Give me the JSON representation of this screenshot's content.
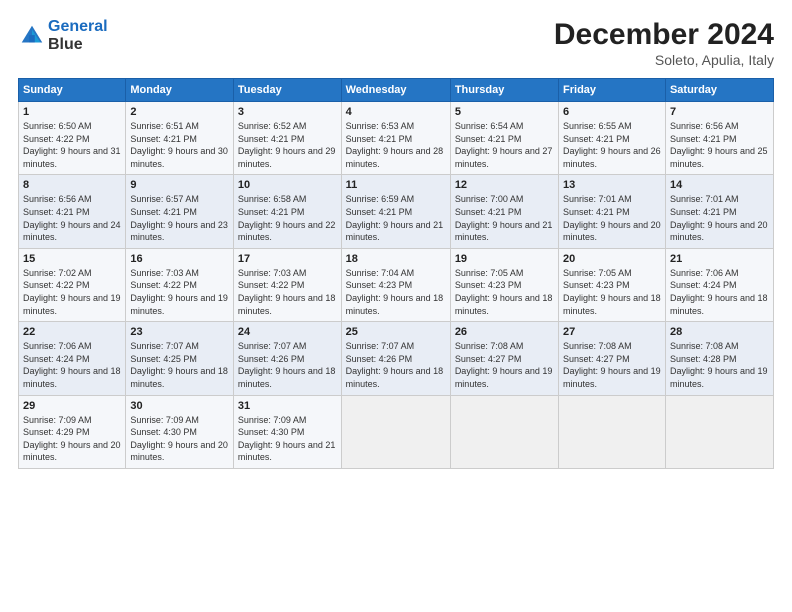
{
  "header": {
    "logo_line1": "General",
    "logo_line2": "Blue",
    "month": "December 2024",
    "location": "Soleto, Apulia, Italy"
  },
  "weekdays": [
    "Sunday",
    "Monday",
    "Tuesday",
    "Wednesday",
    "Thursday",
    "Friday",
    "Saturday"
  ],
  "weeks": [
    [
      {
        "day": "1",
        "sunrise": "6:50 AM",
        "sunset": "4:22 PM",
        "daylight": "9 hours and 31 minutes."
      },
      {
        "day": "2",
        "sunrise": "6:51 AM",
        "sunset": "4:21 PM",
        "daylight": "9 hours and 30 minutes."
      },
      {
        "day": "3",
        "sunrise": "6:52 AM",
        "sunset": "4:21 PM",
        "daylight": "9 hours and 29 minutes."
      },
      {
        "day": "4",
        "sunrise": "6:53 AM",
        "sunset": "4:21 PM",
        "daylight": "9 hours and 28 minutes."
      },
      {
        "day": "5",
        "sunrise": "6:54 AM",
        "sunset": "4:21 PM",
        "daylight": "9 hours and 27 minutes."
      },
      {
        "day": "6",
        "sunrise": "6:55 AM",
        "sunset": "4:21 PM",
        "daylight": "9 hours and 26 minutes."
      },
      {
        "day": "7",
        "sunrise": "6:56 AM",
        "sunset": "4:21 PM",
        "daylight": "9 hours and 25 minutes."
      }
    ],
    [
      {
        "day": "8",
        "sunrise": "6:56 AM",
        "sunset": "4:21 PM",
        "daylight": "9 hours and 24 minutes."
      },
      {
        "day": "9",
        "sunrise": "6:57 AM",
        "sunset": "4:21 PM",
        "daylight": "9 hours and 23 minutes."
      },
      {
        "day": "10",
        "sunrise": "6:58 AM",
        "sunset": "4:21 PM",
        "daylight": "9 hours and 22 minutes."
      },
      {
        "day": "11",
        "sunrise": "6:59 AM",
        "sunset": "4:21 PM",
        "daylight": "9 hours and 21 minutes."
      },
      {
        "day": "12",
        "sunrise": "7:00 AM",
        "sunset": "4:21 PM",
        "daylight": "9 hours and 21 minutes."
      },
      {
        "day": "13",
        "sunrise": "7:01 AM",
        "sunset": "4:21 PM",
        "daylight": "9 hours and 20 minutes."
      },
      {
        "day": "14",
        "sunrise": "7:01 AM",
        "sunset": "4:21 PM",
        "daylight": "9 hours and 20 minutes."
      }
    ],
    [
      {
        "day": "15",
        "sunrise": "7:02 AM",
        "sunset": "4:22 PM",
        "daylight": "9 hours and 19 minutes."
      },
      {
        "day": "16",
        "sunrise": "7:03 AM",
        "sunset": "4:22 PM",
        "daylight": "9 hours and 19 minutes."
      },
      {
        "day": "17",
        "sunrise": "7:03 AM",
        "sunset": "4:22 PM",
        "daylight": "9 hours and 18 minutes."
      },
      {
        "day": "18",
        "sunrise": "7:04 AM",
        "sunset": "4:23 PM",
        "daylight": "9 hours and 18 minutes."
      },
      {
        "day": "19",
        "sunrise": "7:05 AM",
        "sunset": "4:23 PM",
        "daylight": "9 hours and 18 minutes."
      },
      {
        "day": "20",
        "sunrise": "7:05 AM",
        "sunset": "4:23 PM",
        "daylight": "9 hours and 18 minutes."
      },
      {
        "day": "21",
        "sunrise": "7:06 AM",
        "sunset": "4:24 PM",
        "daylight": "9 hours and 18 minutes."
      }
    ],
    [
      {
        "day": "22",
        "sunrise": "7:06 AM",
        "sunset": "4:24 PM",
        "daylight": "9 hours and 18 minutes."
      },
      {
        "day": "23",
        "sunrise": "7:07 AM",
        "sunset": "4:25 PM",
        "daylight": "9 hours and 18 minutes."
      },
      {
        "day": "24",
        "sunrise": "7:07 AM",
        "sunset": "4:26 PM",
        "daylight": "9 hours and 18 minutes."
      },
      {
        "day": "25",
        "sunrise": "7:07 AM",
        "sunset": "4:26 PM",
        "daylight": "9 hours and 18 minutes."
      },
      {
        "day": "26",
        "sunrise": "7:08 AM",
        "sunset": "4:27 PM",
        "daylight": "9 hours and 19 minutes."
      },
      {
        "day": "27",
        "sunrise": "7:08 AM",
        "sunset": "4:27 PM",
        "daylight": "9 hours and 19 minutes."
      },
      {
        "day": "28",
        "sunrise": "7:08 AM",
        "sunset": "4:28 PM",
        "daylight": "9 hours and 19 minutes."
      }
    ],
    [
      {
        "day": "29",
        "sunrise": "7:09 AM",
        "sunset": "4:29 PM",
        "daylight": "9 hours and 20 minutes."
      },
      {
        "day": "30",
        "sunrise": "7:09 AM",
        "sunset": "4:30 PM",
        "daylight": "9 hours and 20 minutes."
      },
      {
        "day": "31",
        "sunrise": "7:09 AM",
        "sunset": "4:30 PM",
        "daylight": "9 hours and 21 minutes."
      },
      null,
      null,
      null,
      null
    ]
  ]
}
